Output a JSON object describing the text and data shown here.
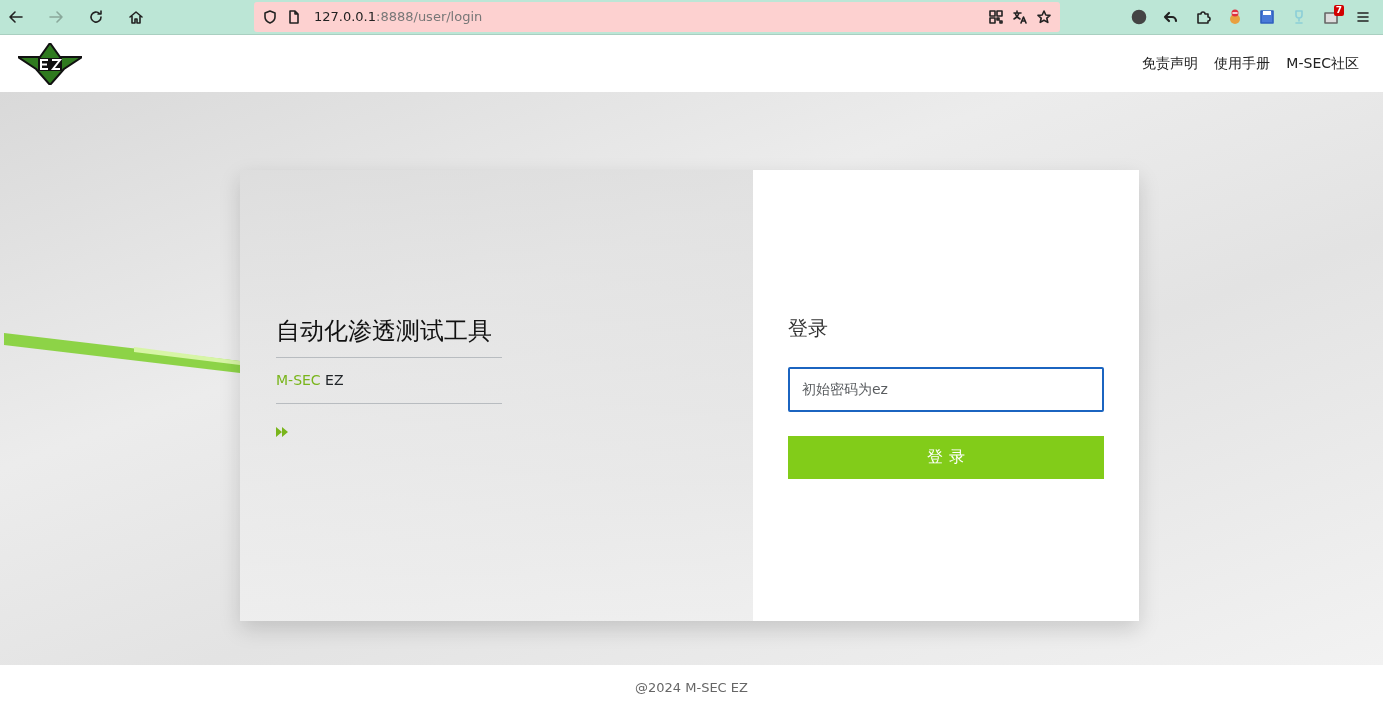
{
  "browser": {
    "forward_disabled": true,
    "url_host": "127.0.0.1",
    "url_path": ":8888/user/login",
    "extension_badge": "7"
  },
  "nav": {
    "links": [
      {
        "label": "免责声明"
      },
      {
        "label": "使用手册"
      },
      {
        "label": "M-SEC社区"
      }
    ]
  },
  "intro": {
    "title": "自动化渗透测试工具",
    "brand_prefix": "M-SEC",
    "brand_suffix": "EZ"
  },
  "login": {
    "title": "登录",
    "password": {
      "placeholder": "初始密码为ez",
      "focused": true
    },
    "submit": "登 录"
  },
  "footer": "@2024 M-SEC EZ"
}
